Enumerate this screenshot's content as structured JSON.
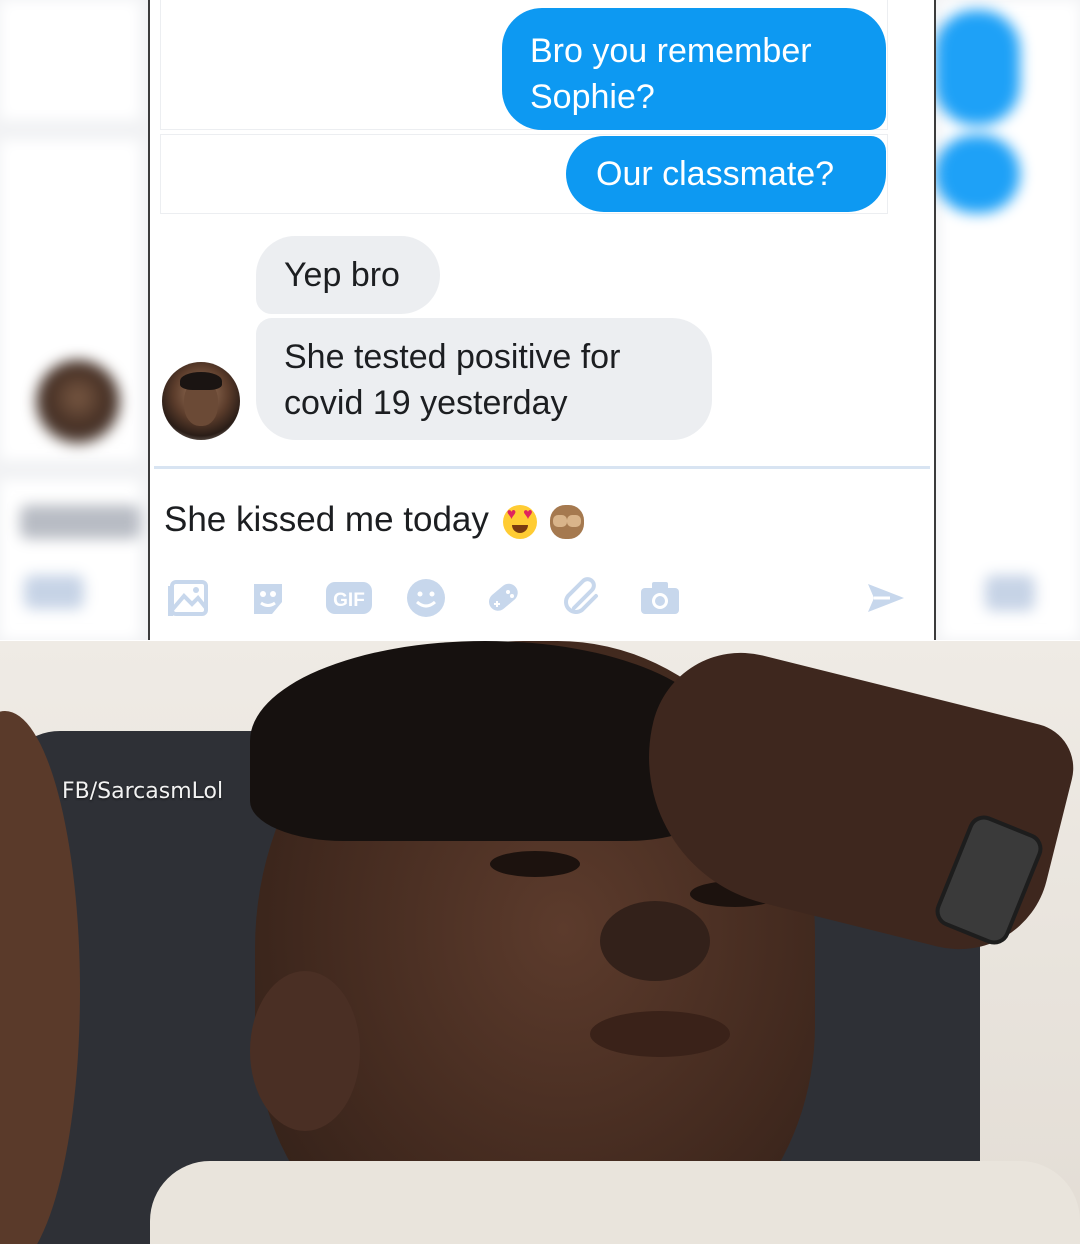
{
  "messages": [
    {
      "side": "outgoing",
      "text": "Bro you remember Sophie?"
    },
    {
      "side": "outgoing",
      "text": "Our classmate?"
    },
    {
      "side": "incoming",
      "text": "Yep bro"
    },
    {
      "side": "incoming",
      "text": "She tested positive for covid 19 yesterday"
    }
  ],
  "compose": {
    "text": "She kissed me today",
    "emojis": [
      "heart-eyes-emoji",
      "see-no-evil-monkey-emoji"
    ]
  },
  "toolbar": {
    "icons": [
      "photo-icon",
      "sticker-icon",
      "gif-icon",
      "emoji-icon",
      "game-controller-icon",
      "attachment-icon",
      "camera-icon",
      "send-icon"
    ],
    "gif_label": "GIF"
  },
  "photo": {
    "watermark": "FB/SarcasmLol"
  },
  "colors": {
    "outgoing_bubble": "#0d99f2",
    "incoming_bubble": "#eceef1",
    "toolbar_icon": "#c7d7ec"
  }
}
